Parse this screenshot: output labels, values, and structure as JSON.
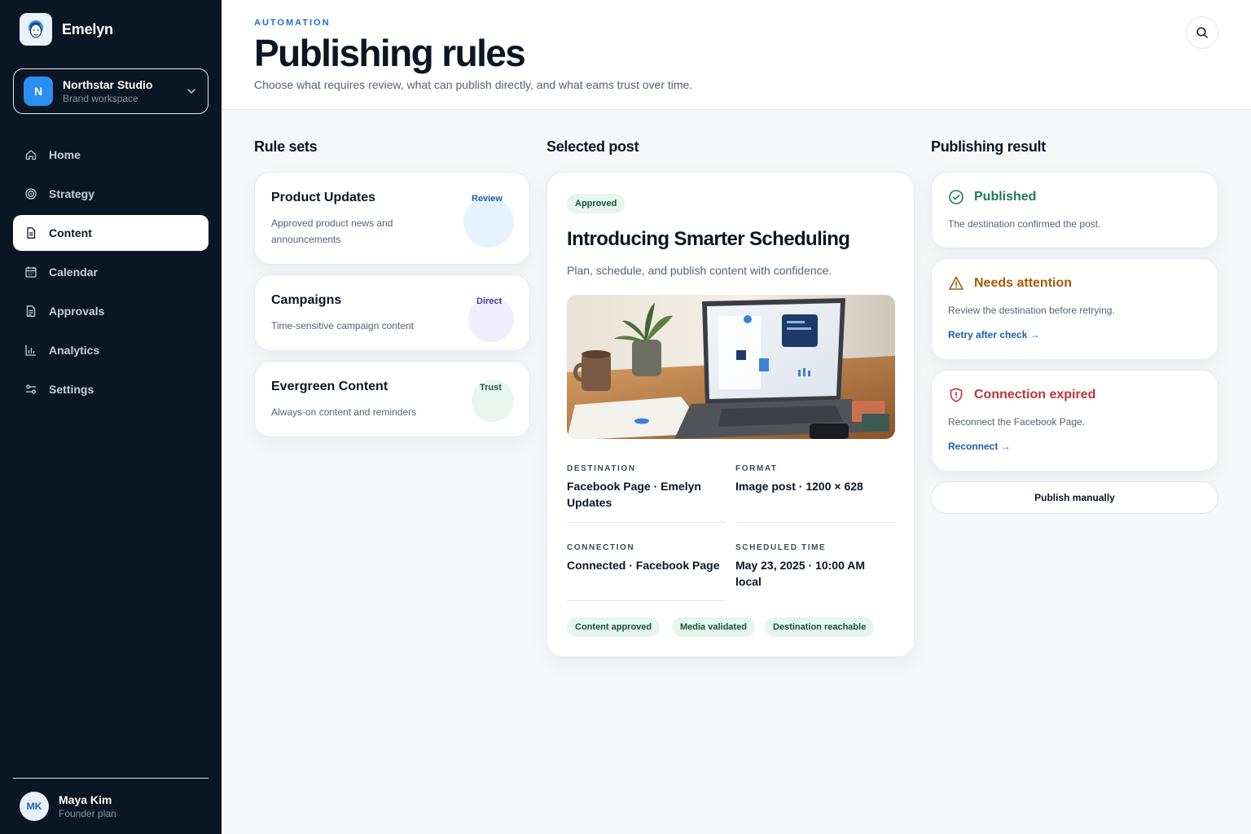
{
  "brand": {
    "name": "Emelyn"
  },
  "workspace": {
    "initial": "N",
    "name": "Northstar Studio",
    "subtitle": "Brand workspace"
  },
  "nav": [
    {
      "label": "Home",
      "icon": "home-icon"
    },
    {
      "label": "Strategy",
      "icon": "target-icon"
    },
    {
      "label": "Content",
      "icon": "document-icon",
      "active": true
    },
    {
      "label": "Calendar",
      "icon": "calendar-icon"
    },
    {
      "label": "Approvals",
      "icon": "approvals-icon"
    },
    {
      "label": "Analytics",
      "icon": "bar-chart-icon"
    },
    {
      "label": "Settings",
      "icon": "sliders-icon"
    }
  ],
  "user": {
    "initials": "MK",
    "name": "Maya Kim",
    "plan": "Founder plan"
  },
  "header": {
    "eyebrow": "AUTOMATION",
    "title": "Publishing rules",
    "description": "Choose what requires review, what can publish directly, and what eams trust over time."
  },
  "rule_sets": {
    "title": "Rule sets",
    "items": [
      {
        "title": "Product Updates",
        "description": "Approved product news and announcements",
        "badge": "Review",
        "color": "#1d5fa8"
      },
      {
        "title": "Campaigns",
        "description": "Time-sensitive campaign content",
        "badge": "Direct",
        "color": "#4b3f9a"
      },
      {
        "title": "Evergreen Content",
        "description": "Always-on content and reminders",
        "badge": "Trust",
        "color": "#1b5a46"
      }
    ]
  },
  "selected_post": {
    "title": "Selected post",
    "status": "Approved",
    "post_title": "Introducing Smarter Scheduling",
    "post_subtitle": "Plan, schedule, and publish content with confidence.",
    "destination": {
      "label": "DESTINATION",
      "value": "Facebook Page · Emelyn Updates"
    },
    "format": {
      "label": "FORMAT",
      "value": "Image post · 1200 × 628"
    },
    "connection": {
      "label": "CONNECTION",
      "value": "Connected · Facebook Page"
    },
    "scheduled": {
      "label": "SCHEDULED TIME",
      "value": "May 23, 2025 · 10:00 AM local"
    },
    "checks": [
      "Content approved",
      "Media validated",
      "Destination reachable"
    ]
  },
  "publishing_result": {
    "title": "Publishing result",
    "items": [
      {
        "title": "Published",
        "description": "The destination confirmed the post.",
        "color": "#1f7a5c",
        "icon": "check-circle-icon"
      },
      {
        "title": "Needs attention",
        "description": "Review the destination before retrying.",
        "link": "Retry after check →",
        "color": "#a35a0c",
        "icon": "warning-icon"
      },
      {
        "title": "Connection expired",
        "description": "Reconnect the Facebook Page.",
        "link": "Reconnect →",
        "color": "#c2323a",
        "icon": "shield-alert-icon"
      }
    ],
    "manual_button": "Publish manually"
  }
}
